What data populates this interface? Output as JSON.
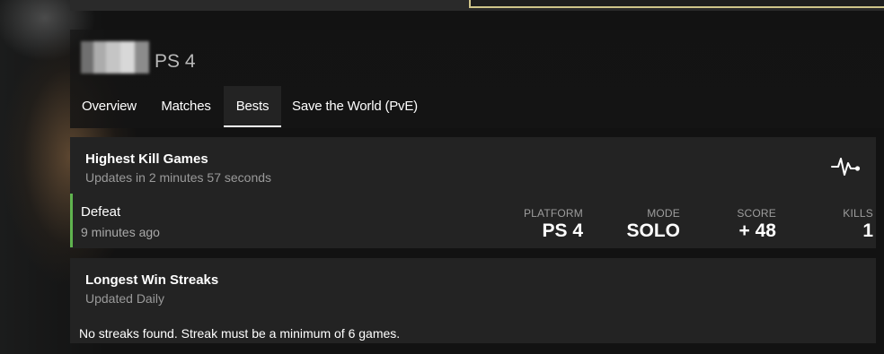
{
  "profile": {
    "platform": "PS 4"
  },
  "tabs": [
    {
      "label": "Overview"
    },
    {
      "label": "Matches"
    },
    {
      "label": "Bests"
    },
    {
      "label": "Save the World (PvE)"
    }
  ],
  "highest_kill": {
    "title": "Highest Kill Games",
    "subtitle": "Updates in 2 minutes 57 seconds",
    "icon": "pulse-icon",
    "match": {
      "result": "Defeat",
      "time_ago": "9 minutes ago",
      "platform_label": "PLATFORM",
      "platform_value": "PS 4",
      "mode_label": "MODE",
      "mode_value": "SOLO",
      "score_label": "SCORE",
      "score_value": "+ 48",
      "kills_label": "KILLS",
      "kills_value": "1"
    }
  },
  "win_streaks": {
    "title": "Longest Win Streaks",
    "subtitle": "Updated Daily",
    "empty_message": "No streaks found. Streak must be a minimum of 6 games."
  },
  "colors": {
    "accent_win_bar": "#5fb34f",
    "panel_bg": "#232323",
    "page_bg": "#121212"
  }
}
